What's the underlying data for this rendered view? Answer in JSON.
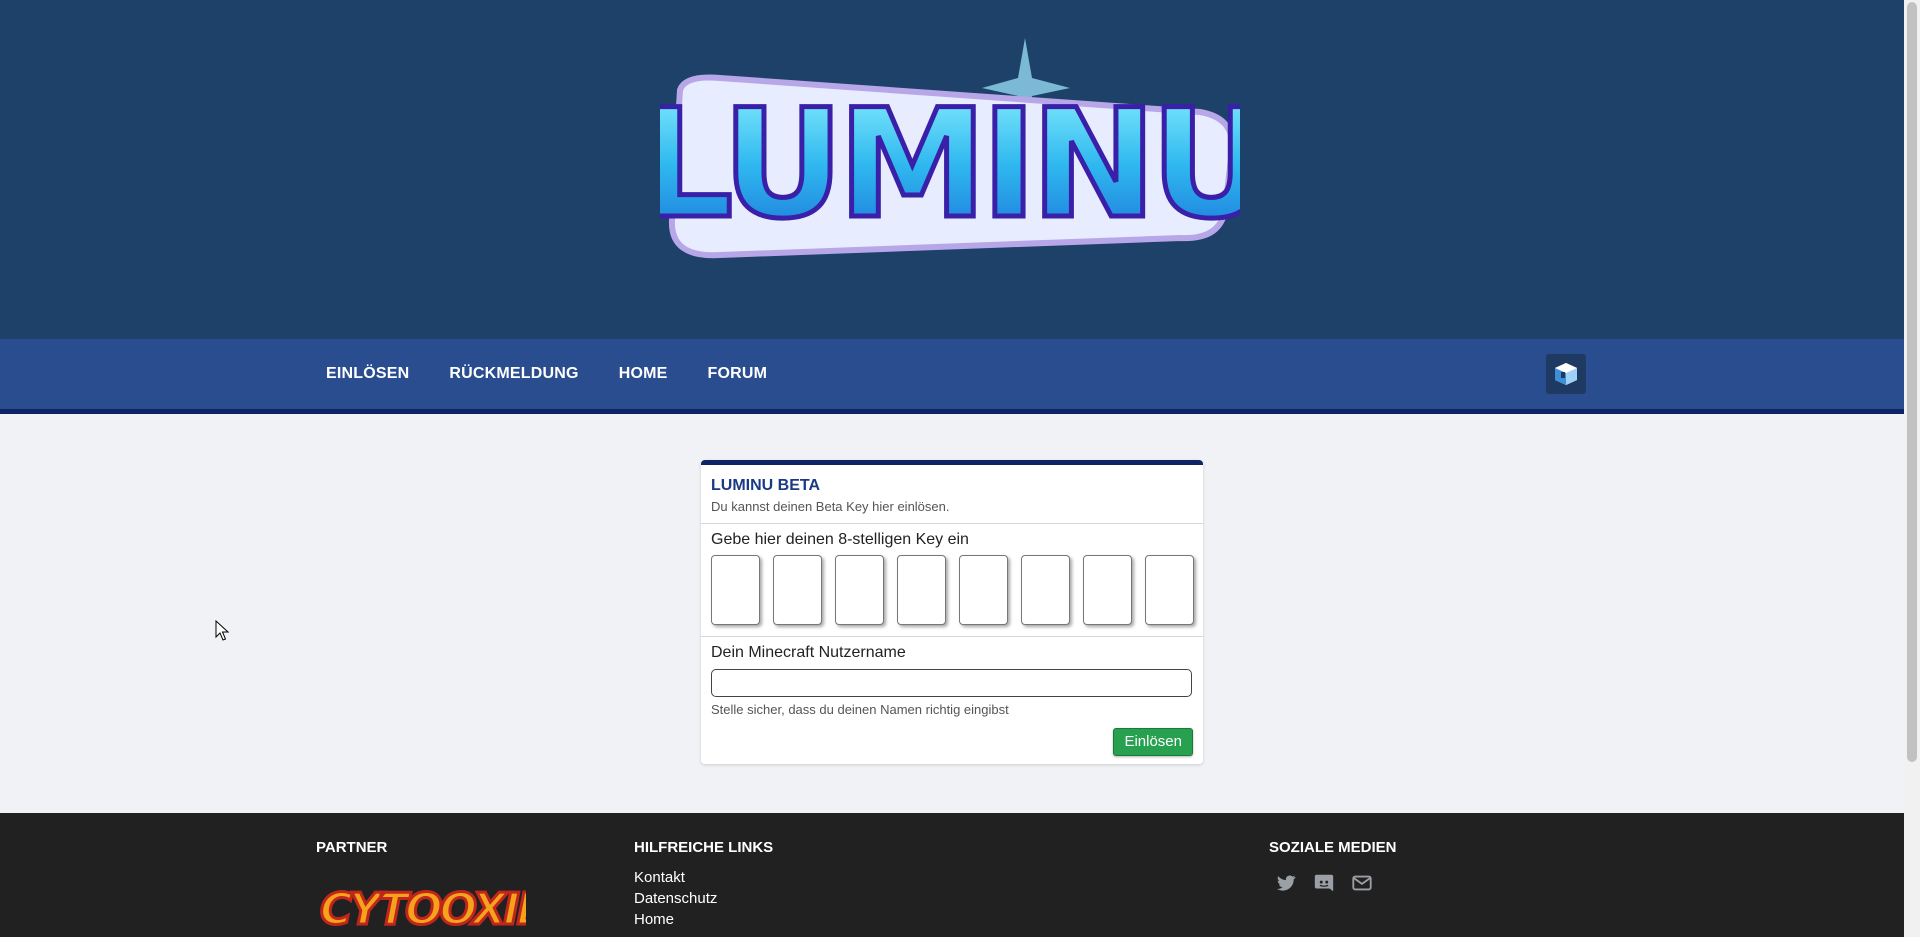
{
  "header": {
    "logo_text": "LUMINU"
  },
  "nav": {
    "items": [
      {
        "label": "EINLÖSEN"
      },
      {
        "label": "RÜCKMELDUNG"
      },
      {
        "label": "HOME"
      },
      {
        "label": "FORUM"
      }
    ],
    "avatar_icon": "cube-avatar-icon"
  },
  "card": {
    "title": "LUMINU BETA",
    "subtitle": "Du kannst deinen Beta Key hier einlösen.",
    "key_label": "Gebe hier deinen 8-stelligen Key ein",
    "key_length": 8,
    "name_label": "Dein Minecraft Nutzername",
    "name_value": "",
    "name_hint": "Stelle sicher, dass du deinen Namen richtig eingibst",
    "submit_label": "Einlösen"
  },
  "footer": {
    "partner_heading": "PARTNER",
    "partner_logo_text": "CYTOOXIEN",
    "links_heading": "HILFREICHE LINKS",
    "links": [
      "Kontakt",
      "Datenschutz",
      "Home"
    ],
    "social_heading": "SOZIALE MEDIEN",
    "social_icons": [
      "twitter-icon",
      "discord-icon",
      "mail-icon"
    ]
  },
  "colors": {
    "header_bg": "#1e416a",
    "nav_bg": "#2a4d8f",
    "accent": "#0e2463",
    "submit": "#27a150",
    "footer_bg": "#212121"
  }
}
